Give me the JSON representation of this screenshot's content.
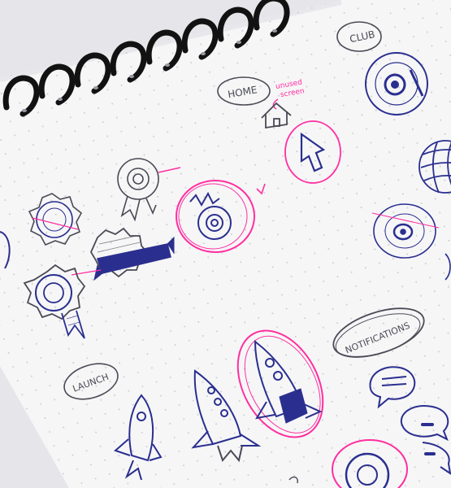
{
  "photo": {
    "labels": {
      "home": "HOME",
      "club": "CLUB",
      "note": [
        "unused",
        "screen"
      ],
      "notifications": "NOTIFICATIONS",
      "launch": "LAUNCH"
    },
    "colors": {
      "background": "#e9e9ec",
      "paper": "#f6f6f7",
      "ink_blue": "#2a2f8f",
      "ink_gray": "#4a4a55",
      "ink_pink": "#ff2fa0",
      "binding": "#151515"
    }
  }
}
